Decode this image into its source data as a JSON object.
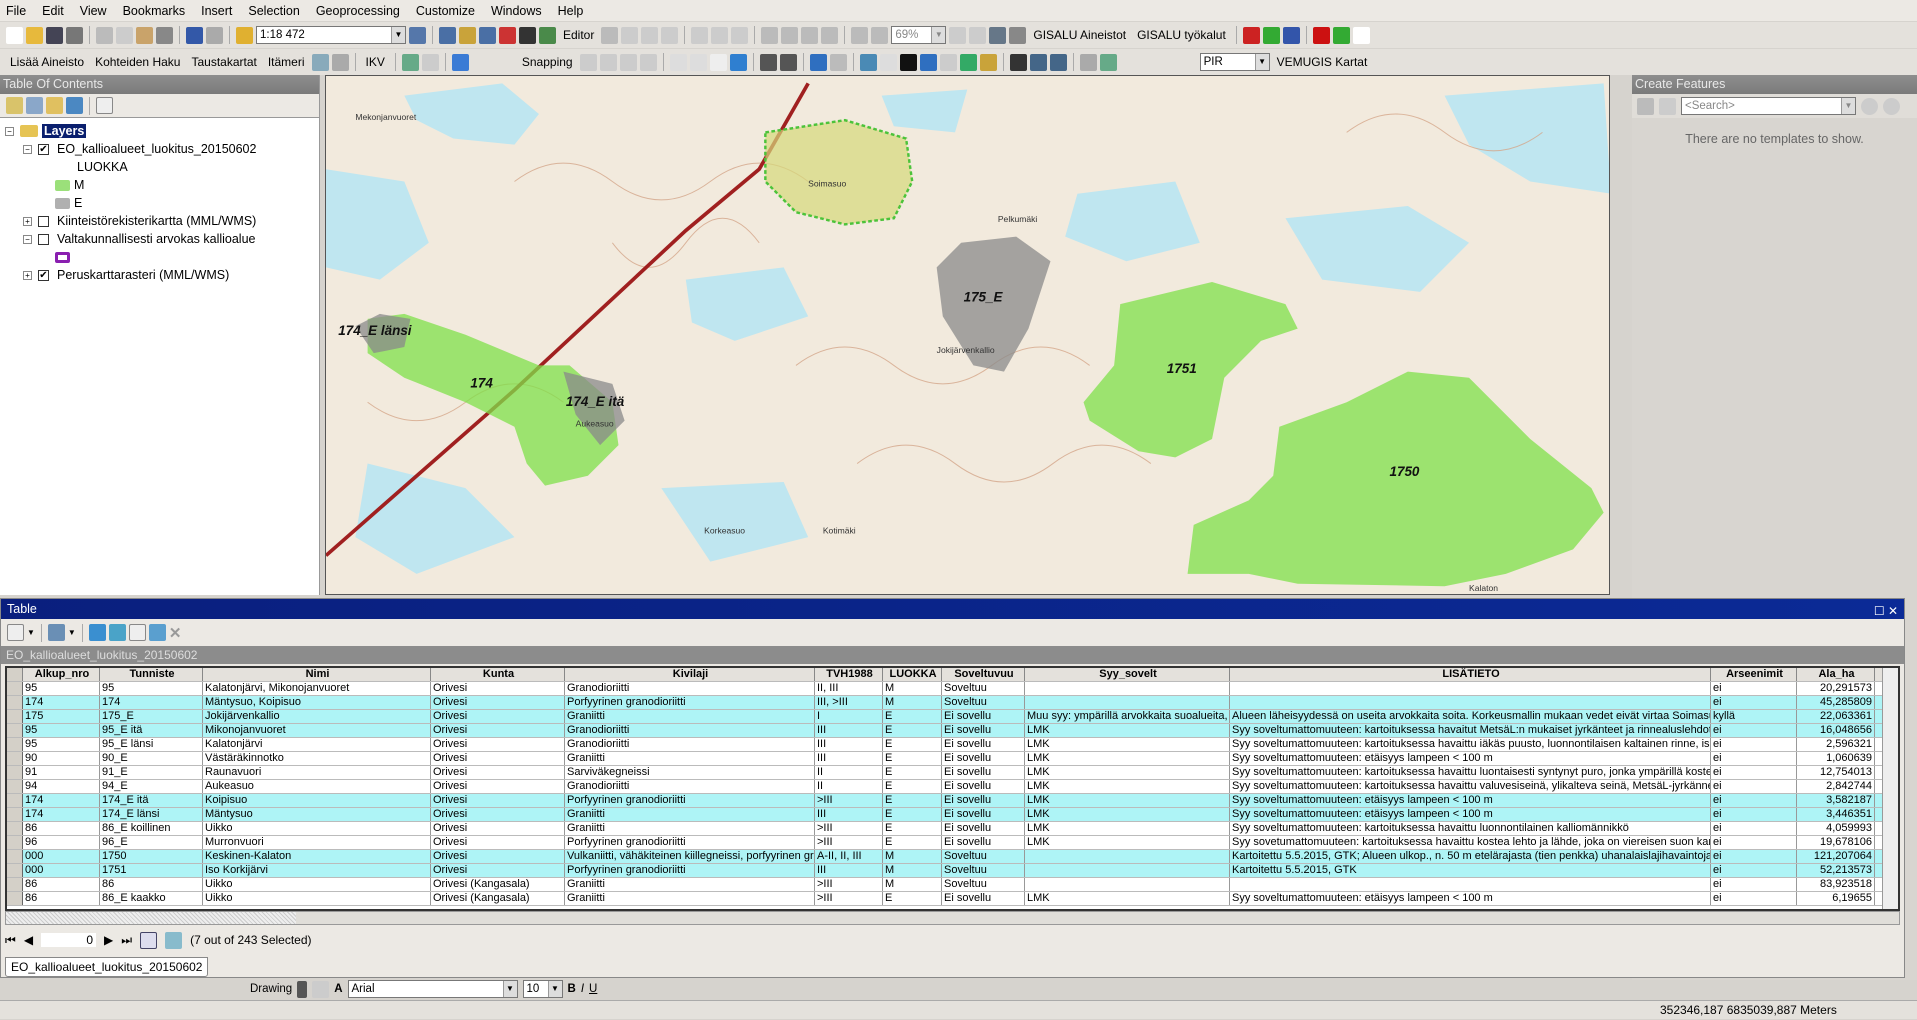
{
  "menu": [
    "File",
    "Edit",
    "View",
    "Bookmarks",
    "Insert",
    "Selection",
    "Geoprocessing",
    "Customize",
    "Windows",
    "Help"
  ],
  "toolbar1": {
    "scale": "1:18 472",
    "editor": "Editor",
    "zoom_percent": "69%",
    "gisalu_aineistot": "GISALU Aineistot",
    "gisalu_tyokalut": "GISALU työkalut"
  },
  "toolbar2": {
    "lisaa": "Lisää Aineisto",
    "kohteiden": "Kohteiden Haku",
    "taustakartat": "Taustakartat",
    "itameri": "Itämeri",
    "ikv": "IKV",
    "snapping": "Snapping",
    "pir": "PIR",
    "vemugis": "VEMUGIS Kartat"
  },
  "toc": {
    "title": "Table Of Contents",
    "root": "Layers",
    "layers": [
      {
        "name": "EO_kallioalueet_luokitus_20150602",
        "checked": true,
        "field": "LUOKKA",
        "classes": [
          {
            "label": "M",
            "color": "#9be07a"
          },
          {
            "label": "E",
            "color": "#b0b0b0"
          }
        ]
      },
      {
        "name": "Kiinteistörekisterikartta (MML/WMS)",
        "checked": false
      },
      {
        "name": "Valtakunnallisesti arvokas kallioalue",
        "checked": false,
        "symbol_color": "#8a1fb0"
      },
      {
        "name": "Peruskarttarasteri (MML/WMS)",
        "checked": true
      }
    ]
  },
  "map": {
    "labels": [
      "174_E länsi",
      "174",
      "174_E itä",
      "175_E",
      "1751",
      "1750"
    ],
    "place_labels": [
      "Soimasuo",
      "Mekonjanvuoret",
      "Pelkumäki",
      "Jokijärvenkallio",
      "Kotimäki",
      "Korkeasuo",
      "Aukeasuo",
      "Kalaton"
    ],
    "colors": {
      "M": "#7fe04a",
      "E": "#8a8a8a",
      "road": "#a02020",
      "water": "#bfe6f0"
    }
  },
  "create_features": {
    "title": "Create Features",
    "search_placeholder": "<Search>",
    "message": "There are no templates to show."
  },
  "table": {
    "title": "Table",
    "layer": "EO_kallioalueet_luokitus_20150602",
    "columns": [
      "Alkup_nro",
      "Tunniste",
      "Nimi",
      "Kunta",
      "Kivilaji",
      "TVH1988",
      "LUOKKA",
      "Soveltuvuu",
      "Syy_sovelt",
      "LISÄTIETO",
      "Arseenimit",
      "Ala_ha"
    ],
    "rows": [
      [
        "95",
        "95",
        "Kalatonjärvi, Mikonojanvuoret",
        "Orivesi",
        "Granodioriitti",
        "II, III",
        "M",
        "Soveltuu",
        "",
        "",
        "ei",
        "20,291573",
        false
      ],
      [
        "174",
        "174",
        "Mäntysuo, Koipisuo",
        "Orivesi",
        "Porfyyrinen granodioriitti",
        "III, >III",
        "M",
        "Soveltuu",
        "",
        "",
        "ei",
        "45,285809",
        true
      ],
      [
        "175",
        "175_E",
        "Jokijärvenkallio",
        "Orivesi",
        "Graniitti",
        "I",
        "E",
        "Ei sovellu",
        "Muu syy: ympärillä arvokkaita suoalueita,",
        "Alueen läheisyydessä on useita arvokkaita soita. Korkeusmallin mukaan vedet eivät virtaa Soimasu",
        "kyllä",
        "22,063361",
        true
      ],
      [
        "95",
        "95_E itä",
        "Mikonojanvuoret",
        "Orivesi",
        "Granodioriitti",
        "III",
        "E",
        "Ei sovellu",
        "LMK",
        "Syy soveltumattomuuteen: kartoituksessa havaitut MetsäL:n mukaiset jyrkänteet ja rinnealuslehdot.",
        "ei",
        "16,048656",
        true
      ],
      [
        "95",
        "95_E länsi",
        "Kalatonjärvi",
        "Orivesi",
        "Granodioriitti",
        "III",
        "E",
        "Ei sovellu",
        "LMK",
        "Syy soveltumattomuuteen: kartoituksessa havaittu iäkäs puusto, luonnontilaisen kaltainen rinne, iso",
        "ei",
        "2,596321",
        false
      ],
      [
        "90",
        "90_E",
        "Västäräkinnotko",
        "Orivesi",
        "Graniitti",
        "III",
        "E",
        "Ei sovellu",
        "LMK",
        "Syy soveltumattomuuteen: etäisyys lampeen < 100 m",
        "ei",
        "1,060639",
        false
      ],
      [
        "91",
        "91_E",
        "Raunavuori",
        "Orivesi",
        "Sarviväkegneissi",
        "II",
        "E",
        "Ei sovellu",
        "LMK",
        "Syy soveltumattomuuteen: kartoituksessa havaittu luontaisesti syntynyt puro, jonka ympärillä kosteit",
        "ei",
        "12,754013",
        false
      ],
      [
        "94",
        "94_E",
        "Aukeasuo",
        "Orivesi",
        "Granodioriitti",
        "II",
        "E",
        "Ei sovellu",
        "LMK",
        "Syy soveltumattomuuteen: kartoituksessa havaittu valuvesiseinä, ylikalteva seinä, MetsäL-jyrkänne",
        "ei",
        "2,842744",
        false
      ],
      [
        "174",
        "174_E itä",
        "Koipisuo",
        "Orivesi",
        "Porfyyrinen granodioriitti",
        ">III",
        "E",
        "Ei sovellu",
        "LMK",
        "Syy soveltumattomuuteen: etäisyys lampeen < 100 m",
        "ei",
        "3,582187",
        true
      ],
      [
        "174",
        "174_E länsi",
        "Mäntysuo",
        "Orivesi",
        "Graniitti",
        "III",
        "E",
        "Ei sovellu",
        "LMK",
        "Syy soveltumattomuuteen: etäisyys lampeen < 100 m",
        "ei",
        "3,446351",
        true
      ],
      [
        "86",
        "86_E koillinen",
        "Uikko",
        "Orivesi",
        "Graniitti",
        ">III",
        "E",
        "Ei sovellu",
        "LMK",
        "Syy soveltumattomuuteen: kartoituksessa havaittu luonnontilainen kalliomännikkö",
        "ei",
        "4,059993",
        false
      ],
      [
        "96",
        "96_E",
        "Murronvuori",
        "Orivesi",
        "Porfyyrinen granodioriitti",
        ">III",
        "E",
        "Ei sovellu",
        "LMK",
        "Syy sovetumattomuuteen: kartoituksessa havaittu kostea lehto ja lähde, joka on viereisen suon kan",
        "ei",
        "19,678106",
        false
      ],
      [
        "000",
        "1750",
        "Keskinen-Kalaton",
        "Orivesi",
        "Vulkaniitti, vähäkiteinen kiillegneissi, porfyyrinen gra",
        "A-II, II, III",
        "M",
        "Soveltuu",
        "",
        "Kartoitettu 5.5.2015, GTK; Alueen ulkop., n. 50 m etelärajasta (tien penkka) uhanalaislajihavaintoja: h",
        "ei",
        "121,207064",
        true
      ],
      [
        "000",
        "1751",
        "Iso Korkijärvi",
        "Orivesi",
        "Porfyyrinen granodioriitti",
        "III",
        "M",
        "Soveltuu",
        "",
        "Kartoitettu 5.5.2015, GTK",
        "ei",
        "52,213573",
        true
      ],
      [
        "86",
        "86",
        "Uikko",
        "Orivesi (Kangasala)",
        "Graniitti",
        ">III",
        "M",
        "Soveltuu",
        "",
        "",
        "ei",
        "83,923518",
        false
      ],
      [
        "86",
        "86_E kaakko",
        "Uikko",
        "Orivesi (Kangasala)",
        "Graniitti",
        ">III",
        "E",
        "Ei sovellu",
        "LMK",
        "Syy soveltumattomuuteen: etäisyys lampeen < 100 m",
        "ei",
        "6,19655",
        false
      ]
    ],
    "record": "0",
    "selection": "(7 out of 243 Selected)",
    "tab": "EO_kallioalueet_luokitus_20150602",
    "highlight": "#aef4f6"
  },
  "drawing": {
    "label": "Drawing",
    "font": "Arial",
    "size": "10"
  },
  "status": {
    "coords": "352346,187  6835039,887 Meters"
  }
}
